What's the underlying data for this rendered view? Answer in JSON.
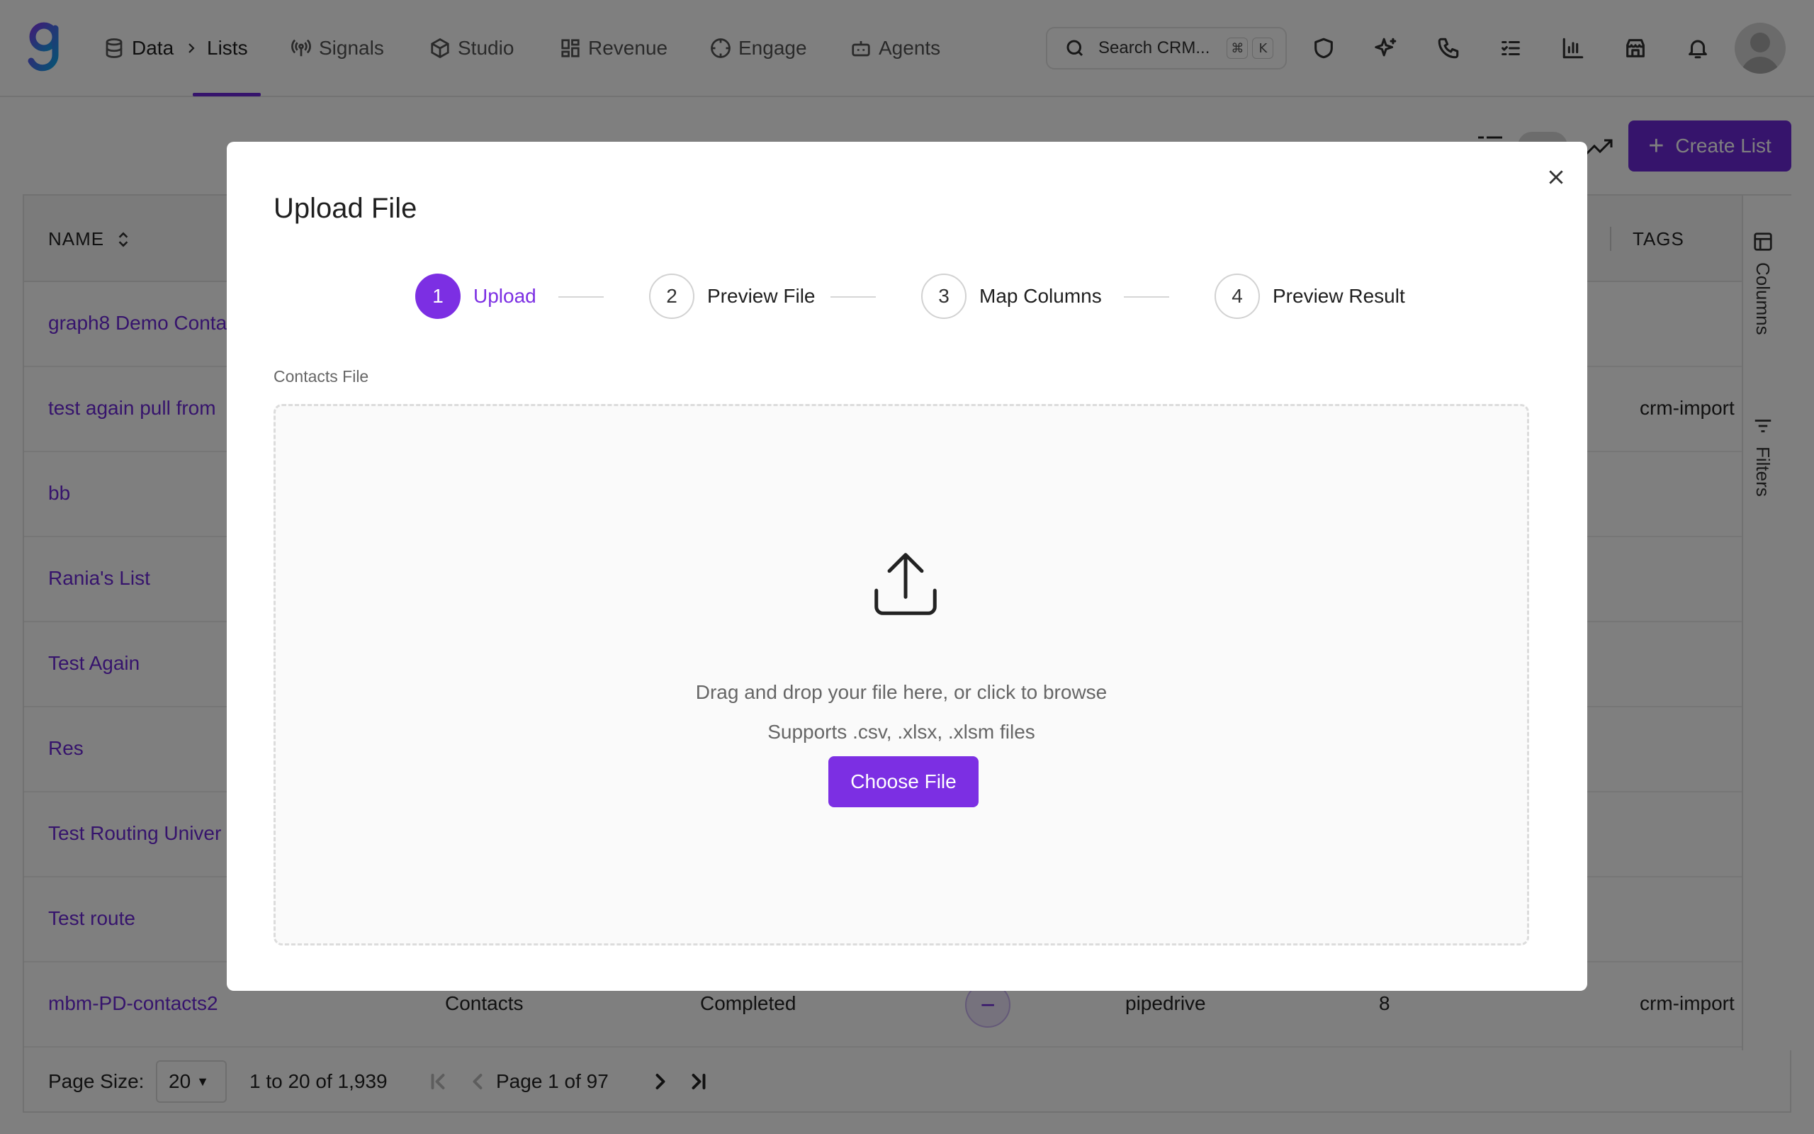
{
  "nav": {
    "breadcrumb_data": "Data",
    "breadcrumb_lists": "Lists",
    "items": [
      {
        "label": "Signals",
        "icon": "signal-icon"
      },
      {
        "label": "Studio",
        "icon": "cube-icon"
      },
      {
        "label": "Revenue",
        "icon": "grid-icon"
      },
      {
        "label": "Engage",
        "icon": "compass-icon"
      },
      {
        "label": "Agents",
        "icon": "bot-icon"
      }
    ],
    "search_placeholder": "Search CRM...",
    "search_kbd_1": "⌘",
    "search_kbd_2": "K"
  },
  "toolbar": {
    "create_label": "Create List"
  },
  "table": {
    "headers": {
      "name": "NAME",
      "tags": "TAGS"
    },
    "rows": [
      {
        "name": "graph8 Demo Conta",
        "tag": ""
      },
      {
        "name": "test again pull from",
        "tag": "crm-import"
      },
      {
        "name": "bb",
        "tag": ""
      },
      {
        "name": "Rania's List",
        "tag": ""
      },
      {
        "name": "Test Again",
        "tag": ""
      },
      {
        "name": "Res",
        "tag": ""
      },
      {
        "name": "Test Routing Univer",
        "tag": ""
      },
      {
        "name": "Test route",
        "tag": ""
      },
      {
        "name": "mbm-PD-contacts2",
        "type": "Contacts",
        "status": "Completed",
        "source": "pipedrive",
        "count": "8",
        "tag": "crm-import"
      }
    ],
    "side_columns": "Columns",
    "side_filters": "Filters"
  },
  "pager": {
    "page_size_label": "Page Size:",
    "page_size_value": "20",
    "range": "1 to 20 of 1,939",
    "page": "Page 1 of 97"
  },
  "modal": {
    "title": "Upload File",
    "steps": [
      {
        "num": "1",
        "label": "Upload"
      },
      {
        "num": "2",
        "label": "Preview File"
      },
      {
        "num": "3",
        "label": "Map Columns"
      },
      {
        "num": "4",
        "label": "Preview Result"
      }
    ],
    "field_label": "Contacts File",
    "drop_text": "Drag and drop your file here, or click to browse",
    "supports_text": "Supports .csv, .xlsx, .xlsm files",
    "choose_label": "Choose File"
  },
  "colors": {
    "accent": "#7c2fe3",
    "accent_dark": "#6d28d9"
  }
}
